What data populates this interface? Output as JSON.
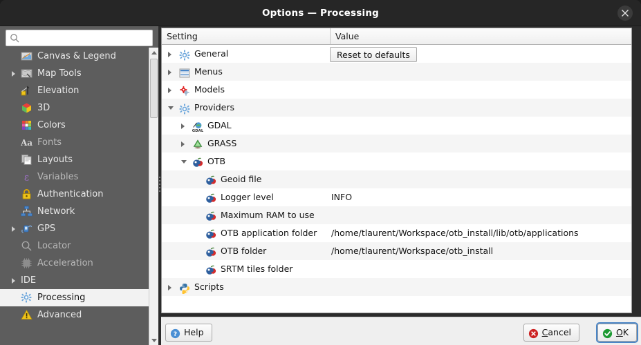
{
  "window": {
    "title": "Options — Processing",
    "close_icon": "close-icon"
  },
  "sidebar": {
    "search": {
      "value": "",
      "placeholder": "",
      "icon": "search-icon"
    },
    "items": [
      {
        "label": "Canvas & Legend",
        "icon": "canvas-legend-icon",
        "expandable": false,
        "selected": false
      },
      {
        "label": "Map Tools",
        "icon": "map-tools-icon",
        "expandable": true,
        "selected": false
      },
      {
        "label": "Elevation",
        "icon": "elevation-icon",
        "expandable": false,
        "selected": false
      },
      {
        "label": "3D",
        "icon": "cube-3d-icon",
        "expandable": false,
        "selected": false
      },
      {
        "label": "Colors",
        "icon": "colors-icon",
        "expandable": false,
        "selected": false
      },
      {
        "label": "Fonts",
        "icon": "fonts-icon",
        "expandable": false,
        "selected": false
      },
      {
        "label": "Layouts",
        "icon": "layouts-icon",
        "expandable": false,
        "selected": false
      },
      {
        "label": "Variables",
        "icon": "variables-icon",
        "expandable": false,
        "selected": false
      },
      {
        "label": "Authentication",
        "icon": "lock-icon",
        "expandable": false,
        "selected": false
      },
      {
        "label": "Network",
        "icon": "network-icon",
        "expandable": false,
        "selected": false
      },
      {
        "label": "GPS",
        "icon": "gps-icon",
        "expandable": true,
        "selected": false
      },
      {
        "label": "Locator",
        "icon": "locator-icon",
        "expandable": false,
        "selected": false
      },
      {
        "label": "Acceleration",
        "icon": "acceleration-icon",
        "expandable": false,
        "selected": false
      },
      {
        "label": "IDE",
        "icon": "none",
        "expandable": true,
        "selected": false
      },
      {
        "label": "Processing",
        "icon": "gear-blue-icon",
        "expandable": false,
        "selected": true
      },
      {
        "label": "Advanced",
        "icon": "warning-icon",
        "expandable": false,
        "selected": false
      }
    ],
    "scrollbar": {
      "up_icon": "scroll-up-icon",
      "down_icon": "scroll-down-icon"
    }
  },
  "tree": {
    "columns": [
      "Setting",
      "Value"
    ],
    "reset_button": "Reset to defaults",
    "rows": [
      {
        "label": "General",
        "value": "",
        "depth": 0,
        "icon": "gear-blue-icon",
        "state": "collapsed"
      },
      {
        "label": "Menus",
        "value": "",
        "depth": 0,
        "icon": "menus-icon",
        "state": "collapsed"
      },
      {
        "label": "Models",
        "value": "",
        "depth": 0,
        "icon": "gear-red-icon",
        "state": "collapsed"
      },
      {
        "label": "Providers",
        "value": "",
        "depth": 0,
        "icon": "gear-blue-icon",
        "state": "expanded"
      },
      {
        "label": "GDAL",
        "value": "",
        "depth": 1,
        "icon": "gdal-icon",
        "state": "collapsed"
      },
      {
        "label": "GRASS",
        "value": "",
        "depth": 1,
        "icon": "grass-icon",
        "state": "collapsed"
      },
      {
        "label": "OTB",
        "value": "",
        "depth": 1,
        "icon": "otb-icon",
        "state": "expanded"
      },
      {
        "label": "Geoid file",
        "value": "",
        "depth": 2,
        "icon": "otb-icon",
        "state": "leaf"
      },
      {
        "label": "Logger level",
        "value": "INFO",
        "depth": 2,
        "icon": "otb-icon",
        "state": "leaf"
      },
      {
        "label": "Maximum RAM to use",
        "value": "",
        "depth": 2,
        "icon": "otb-icon",
        "state": "leaf"
      },
      {
        "label": "OTB application folder",
        "value": "/home/tlaurent/Workspace/otb_install/lib/otb/applications",
        "depth": 2,
        "icon": "otb-icon",
        "state": "leaf"
      },
      {
        "label": "OTB folder",
        "value": "/home/tlaurent/Workspace/otb_install",
        "depth": 2,
        "icon": "otb-icon",
        "state": "leaf"
      },
      {
        "label": "SRTM tiles folder",
        "value": "",
        "depth": 2,
        "icon": "otb-icon",
        "state": "leaf"
      },
      {
        "label": "Scripts",
        "value": "",
        "depth": 0,
        "icon": "python-icon",
        "state": "collapsed"
      }
    ]
  },
  "buttons": {
    "help": {
      "label": "Help",
      "accel": "",
      "icon": "help-icon"
    },
    "cancel": {
      "label": "Cancel",
      "accel": "C",
      "icon": "cancel-icon"
    },
    "ok": {
      "label": "OK",
      "accel": "O",
      "icon": "ok-icon"
    }
  },
  "colors": {
    "sidebar_bg": "#5d5d5d",
    "titlebar_bg": "#262626",
    "selection_bg": "#f2f2f2",
    "focus_ring": "#4b86c7",
    "row_alt": "#f5f5f5"
  }
}
